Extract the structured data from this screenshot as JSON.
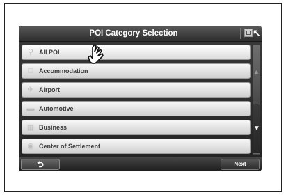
{
  "header": {
    "title": "POI Category Selection"
  },
  "icons": {
    "map": "map-icon",
    "back": "back-arrow-icon",
    "hand": "hand-pointer-icon"
  },
  "list": {
    "items": [
      {
        "label": "All POI",
        "icon": "search-icon"
      },
      {
        "label": "Accommodation",
        "icon": "hotel-icon"
      },
      {
        "label": "Airport",
        "icon": "airplane-icon"
      },
      {
        "label": "Automotive",
        "icon": "car-icon"
      },
      {
        "label": "Business",
        "icon": "building-icon"
      },
      {
        "label": "Center of Settlement",
        "icon": "settlement-icon"
      }
    ]
  },
  "footer": {
    "back_symbol": "⮌",
    "next_label": "Next"
  },
  "colors": {
    "panel": "#2c2c2c",
    "item": "#e6e6e6",
    "text": "#3a3a3a"
  }
}
